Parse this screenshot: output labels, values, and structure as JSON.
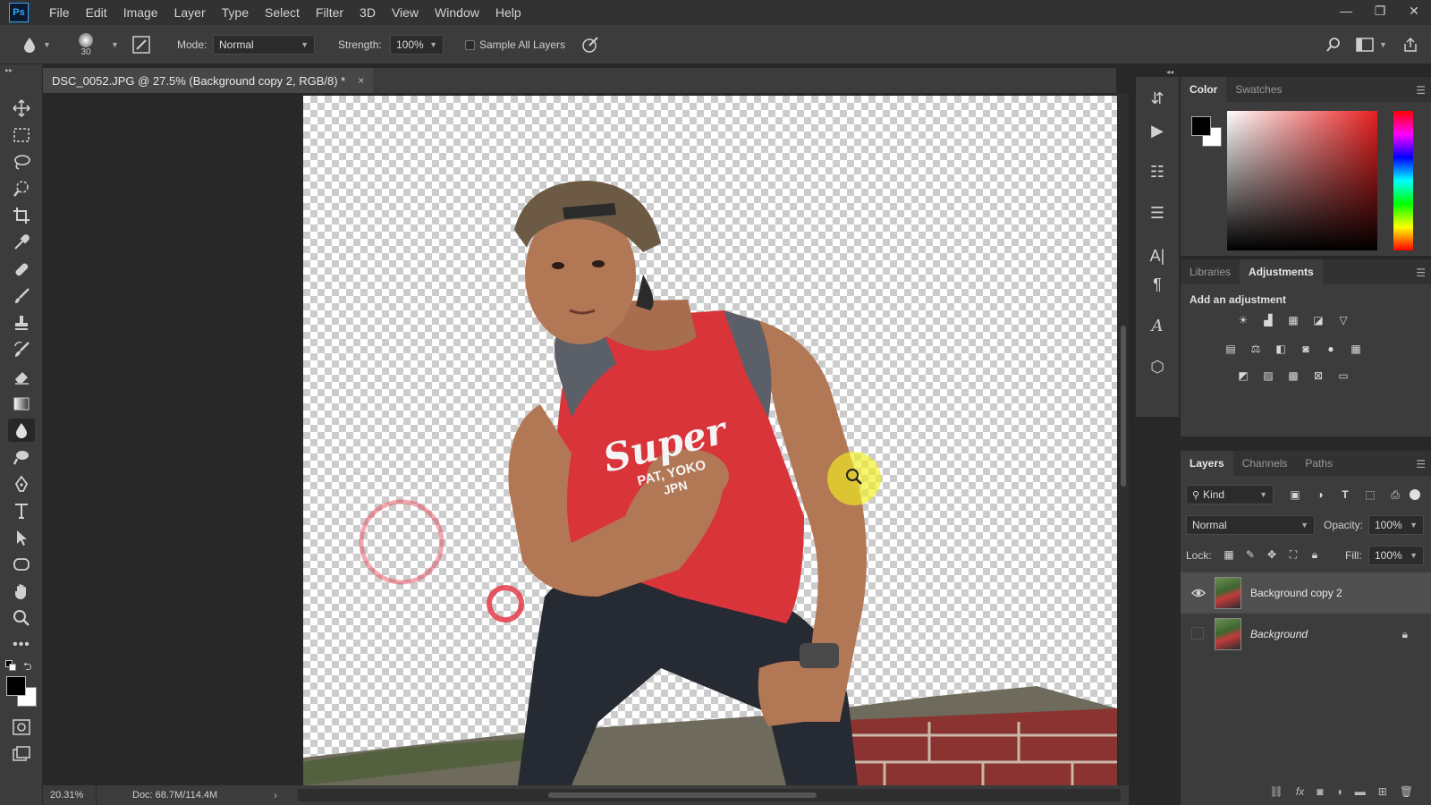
{
  "app": {
    "logo": "Ps"
  },
  "menu": [
    "File",
    "Edit",
    "Image",
    "Layer",
    "Type",
    "Select",
    "Filter",
    "3D",
    "View",
    "Window",
    "Help"
  ],
  "options": {
    "brush_size": "30",
    "mode_label": "Mode:",
    "mode_value": "Normal",
    "strength_label": "Strength:",
    "strength_value": "100%",
    "sample_all_layers": "Sample All Layers"
  },
  "document": {
    "tab_title": "DSC_0052.JPG @ 27.5% (Background copy 2, RGB/8) *",
    "close": "×"
  },
  "status": {
    "zoom": "20.31%",
    "doc": "Doc: 68.7M/114.4M"
  },
  "color_panel": {
    "tabs": [
      "Color",
      "Swatches"
    ],
    "active": "Color"
  },
  "adjustments_panel": {
    "tabs": [
      "Libraries",
      "Adjustments"
    ],
    "active": "Adjustments",
    "title": "Add an adjustment"
  },
  "layers_panel": {
    "tabs": [
      "Layers",
      "Channels",
      "Paths"
    ],
    "active": "Layers",
    "filter_kind": "Kind",
    "blend_mode": "Normal",
    "opacity_label": "Opacity:",
    "opacity_value": "100%",
    "lock_label": "Lock:",
    "fill_label": "Fill:",
    "fill_value": "100%",
    "layers": [
      {
        "name": "Background copy 2",
        "visible": true,
        "selected": true,
        "locked": false
      },
      {
        "name": "Background",
        "visible": false,
        "selected": false,
        "locked": true
      }
    ]
  },
  "shirt_text": {
    "brand": "Super",
    "line2": "PAT, YOKO",
    "line3": "JPN"
  },
  "colors": {
    "accent": "#31a8ff",
    "panel_bg": "#3c3c3c",
    "shirt_red": "#d8343a",
    "cursor_yellow": "#f2f020"
  }
}
